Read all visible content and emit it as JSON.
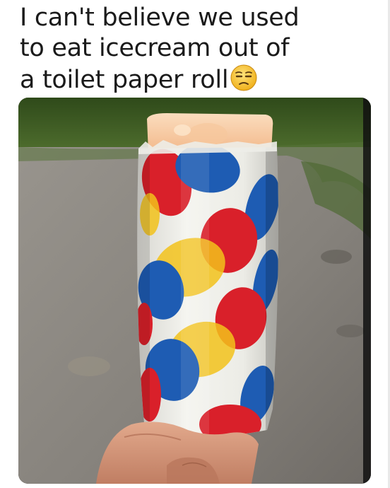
{
  "caption": {
    "line1": "I can't believe we used",
    "line2": "to eat icecream out of",
    "line3": "a toilet paper roll"
  },
  "emoji": {
    "name": "unamused-face-icon",
    "color": "#F5C02A"
  },
  "photo": {
    "subject": "push-pop ice cream in polka dot paper tube",
    "dot_colors": [
      "#D9202A",
      "#1E5CB3",
      "#F2C21B"
    ],
    "wrapper_color": "#EFEFEA",
    "icecream_color": "#F7C9A0",
    "grass_color": "#3D5A22",
    "pavement_color": "#8E8A84"
  }
}
